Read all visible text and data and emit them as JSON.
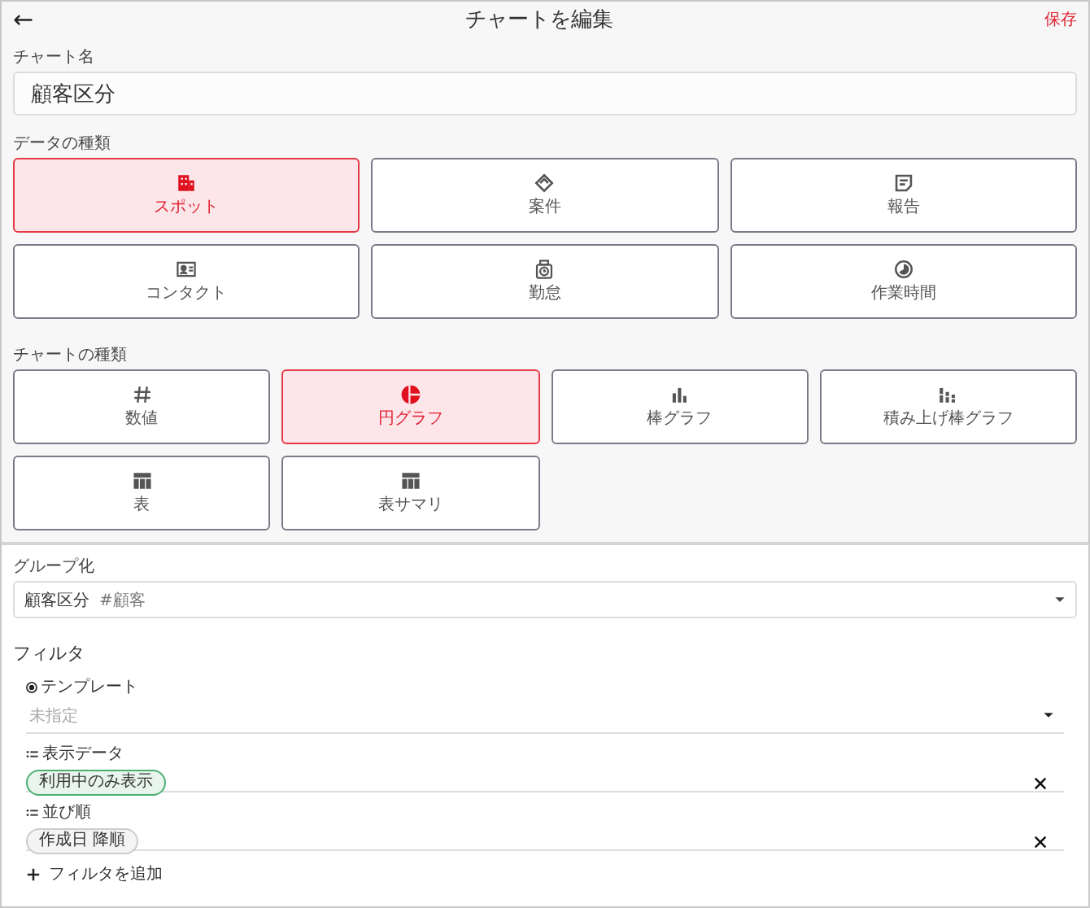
{
  "header": {
    "back": "←",
    "title": "チャートを編集",
    "save": "保存"
  },
  "chart_name": {
    "label": "チャート名",
    "value": "顧客区分"
  },
  "data_type": {
    "label": "データの種類",
    "options": [
      {
        "label": "スポット",
        "kind": "building",
        "selected": true
      },
      {
        "label": "案件",
        "kind": "tag",
        "selected": false
      },
      {
        "label": "報告",
        "kind": "note",
        "selected": false
      },
      {
        "label": "コンタクト",
        "kind": "card",
        "selected": false
      },
      {
        "label": "勤怠",
        "kind": "timer",
        "selected": false
      },
      {
        "label": "作業時間",
        "kind": "clock",
        "selected": false
      }
    ]
  },
  "chart_type": {
    "label": "チャートの種類",
    "options": [
      {
        "label": "数値",
        "kind": "number",
        "selected": false
      },
      {
        "label": "円グラフ",
        "kind": "pie",
        "selected": true
      },
      {
        "label": "棒グラフ",
        "kind": "bar",
        "selected": false
      },
      {
        "label": "積み上げ棒グラフ",
        "kind": "stacked",
        "selected": false
      },
      {
        "label": "表",
        "kind": "table",
        "selected": false
      },
      {
        "label": "表サマリ",
        "kind": "table",
        "selected": false
      }
    ]
  },
  "grouping": {
    "label": "グループ化",
    "value": "顧客区分",
    "tag": "#顧客"
  },
  "filter": {
    "title": "フィルタ",
    "template": {
      "label": "テンプレート",
      "checked": true,
      "placeholder": "未指定"
    },
    "rows": [
      {
        "label": "表示データ",
        "chip": "利用中のみ表示",
        "highlighted": true
      },
      {
        "label": "並び順",
        "chip": "作成日 降順",
        "highlighted": false
      }
    ],
    "add": "フィルタを追加"
  }
}
